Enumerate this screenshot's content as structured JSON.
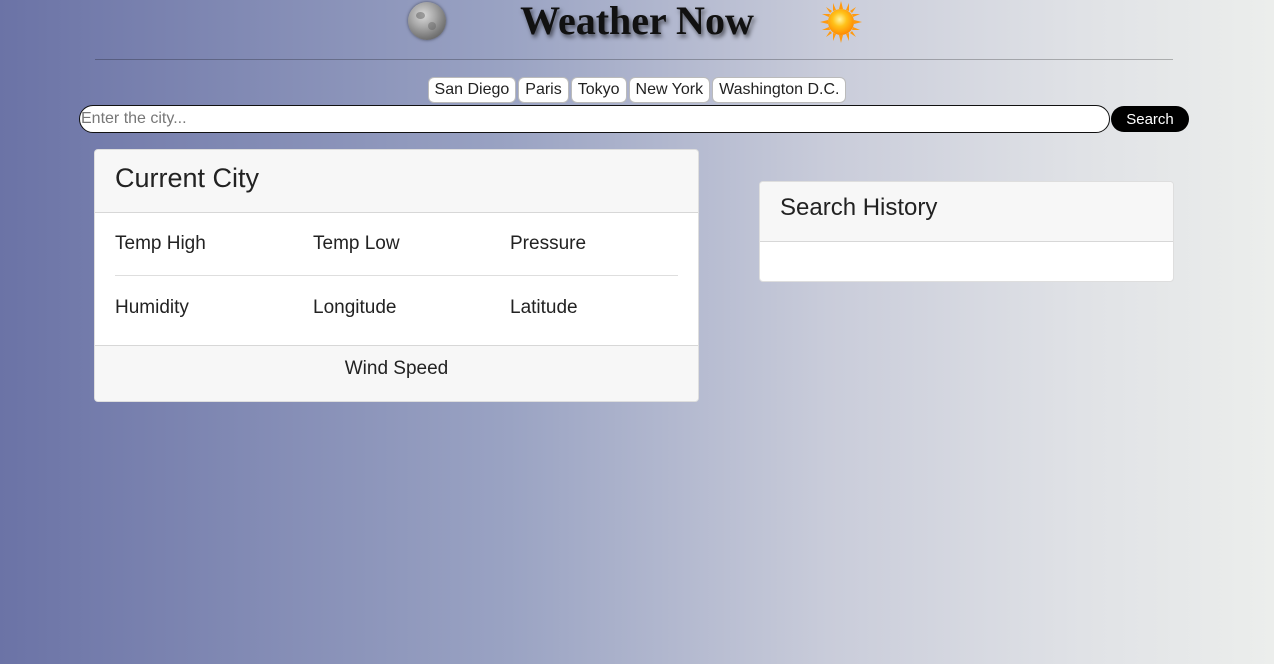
{
  "header": {
    "title": "Weather Now",
    "left_icon": "moon-icon",
    "right_icon": "sun-icon"
  },
  "cities": [
    "San Diego",
    "Paris",
    "Tokyo",
    "New York",
    "Washington D.C."
  ],
  "search": {
    "placeholder": "Enter the city...",
    "value": "",
    "button_label": "Search"
  },
  "current_city": {
    "title": "Current City",
    "fields": {
      "temp_high": "Temp High",
      "temp_low": "Temp Low",
      "pressure": "Pressure",
      "humidity": "Humidity",
      "longitude": "Longitude",
      "latitude": "Latitude"
    },
    "footer": "Wind Speed"
  },
  "history": {
    "title": "Search History",
    "items": []
  },
  "colors": {
    "gradient_start": "#6b73a6",
    "gradient_end": "#eceeec",
    "button_bg": "#000000"
  }
}
